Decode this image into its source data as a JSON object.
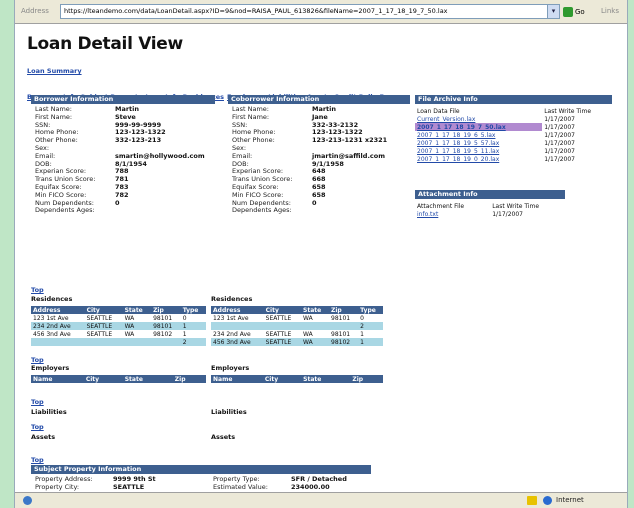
{
  "browser": {
    "address_label": "Address",
    "url": "https://lteandemo.com/data/LoanDetail.aspx?ID=9&nod=RAISA_PAUL_613826&fileName=2007_1_17_18_19_7_50.lax",
    "go_label": "Go",
    "links_label": "Links",
    "status_zone": "Internet"
  },
  "page": {
    "title": "Loan Detail View",
    "summary_link": "Loan Summary",
    "nav": [
      "Borrower Info",
      "Subject Property",
      "Loan Info",
      "Residences",
      "Employers",
      "Liabilities",
      "Assets",
      "Credit Pulls",
      "Fees"
    ]
  },
  "borrower": {
    "header": "Borrower Information",
    "rows": [
      {
        "k": "Last Name:",
        "v": "Martin"
      },
      {
        "k": "First Name:",
        "v": "Steve"
      },
      {
        "k": "SSN:",
        "v": "999-99-9999"
      },
      {
        "k": "Home Phone:",
        "v": "123-123-1322"
      },
      {
        "k": "Other Phone:",
        "v": "332-123-213"
      },
      {
        "k": "Sex:",
        "v": ""
      },
      {
        "k": "Email:",
        "v": "smartin@hollywood.com"
      },
      {
        "k": "DOB:",
        "v": "8/1/1954"
      },
      {
        "k": "Experian Score:",
        "v": "788"
      },
      {
        "k": "Trans Union Score:",
        "v": "781"
      },
      {
        "k": "Equifax Score:",
        "v": "783"
      },
      {
        "k": "Min FICO Score:",
        "v": "782"
      },
      {
        "k": "Num Dependents:",
        "v": "0"
      },
      {
        "k": "Dependents Ages:",
        "v": ""
      }
    ]
  },
  "coborrower": {
    "header": "Coborrower Information",
    "rows": [
      {
        "k": "Last Name:",
        "v": "Martin"
      },
      {
        "k": "First Name:",
        "v": "Jane"
      },
      {
        "k": "SSN:",
        "v": "332-33-2132"
      },
      {
        "k": "Home Phone:",
        "v": "123-123-1322"
      },
      {
        "k": "Other Phone:",
        "v": "123-213-1231 x2321"
      },
      {
        "k": "Sex:",
        "v": ""
      },
      {
        "k": "Email:",
        "v": "jmartin@saffild.com"
      },
      {
        "k": "DOB:",
        "v": "9/1/1958"
      },
      {
        "k": "Experian Score:",
        "v": "648"
      },
      {
        "k": "Trans Union Score:",
        "v": "668"
      },
      {
        "k": "Equifax Score:",
        "v": "658"
      },
      {
        "k": "Min FICO Score:",
        "v": "658"
      },
      {
        "k": "Num Dependents:",
        "v": "0"
      },
      {
        "k": "Dependents Ages:",
        "v": ""
      }
    ]
  },
  "file_archive": {
    "header": "File Archive Info",
    "col1": "Loan Data File",
    "col2": "Last Write Time",
    "rows": [
      {
        "file": "Current_Version.lax",
        "time": "1/17/2007"
      },
      {
        "file": "2007_1_17_18_19_7_50.lax",
        "time": "1/17/2007"
      },
      {
        "file": "2007_1_17_18_19_6_5.lax",
        "time": "1/17/2007"
      },
      {
        "file": "2007_1_17_18_19_5_57.lax",
        "time": "1/17/2007"
      },
      {
        "file": "2007_1_17_18_19_5_11.lax",
        "time": "1/17/2007"
      },
      {
        "file": "2007_1_17_18_19_0_20.lax",
        "time": "1/17/2007"
      }
    ]
  },
  "attachment": {
    "header": "Attachment Info",
    "col1": "Attachment File",
    "col2": "Last Write Time",
    "rows": [
      {
        "file": "info.txt",
        "time": "1/17/2007"
      }
    ]
  },
  "top_label": "Top",
  "residences": {
    "title": "Residences",
    "cols": [
      "Address",
      "City",
      "State",
      "Zip",
      "Type"
    ],
    "left": [
      [
        "123 1st Ave",
        "SEATTLE",
        "WA",
        "98101",
        "0"
      ],
      [
        "234 2nd Ave",
        "SEATTLE",
        "WA",
        "98101",
        "1"
      ],
      [
        "456 3nd Ave",
        "SEATTLE",
        "WA",
        "98102",
        "1"
      ],
      [
        "",
        "",
        "",
        "",
        "2"
      ]
    ],
    "right": [
      [
        "123 1st Ave",
        "SEATTLE",
        "WA",
        "98101",
        "0"
      ],
      [
        "",
        "",
        "",
        "",
        "2"
      ],
      [
        "234 2nd Ave",
        "SEATTLE",
        "WA",
        "98101",
        "1"
      ],
      [
        "456 3nd Ave",
        "SEATTLE",
        "WA",
        "98102",
        "1"
      ]
    ]
  },
  "employers": {
    "title": "Employers",
    "cols": [
      "Name",
      "City",
      "State",
      "Zip"
    ]
  },
  "liabilities": {
    "title": "Liabilities"
  },
  "assets": {
    "title": "Assets"
  },
  "subject_property": {
    "header": "Subject Property Information",
    "left": [
      {
        "k": "Property Address:",
        "v": "9999 9th St"
      },
      {
        "k": "Property City:",
        "v": "SEATTLE"
      }
    ],
    "right": [
      {
        "k": "Property Type:",
        "v": "SFR / Detached"
      },
      {
        "k": "Estimated Value:",
        "v": "234000.00"
      }
    ]
  }
}
